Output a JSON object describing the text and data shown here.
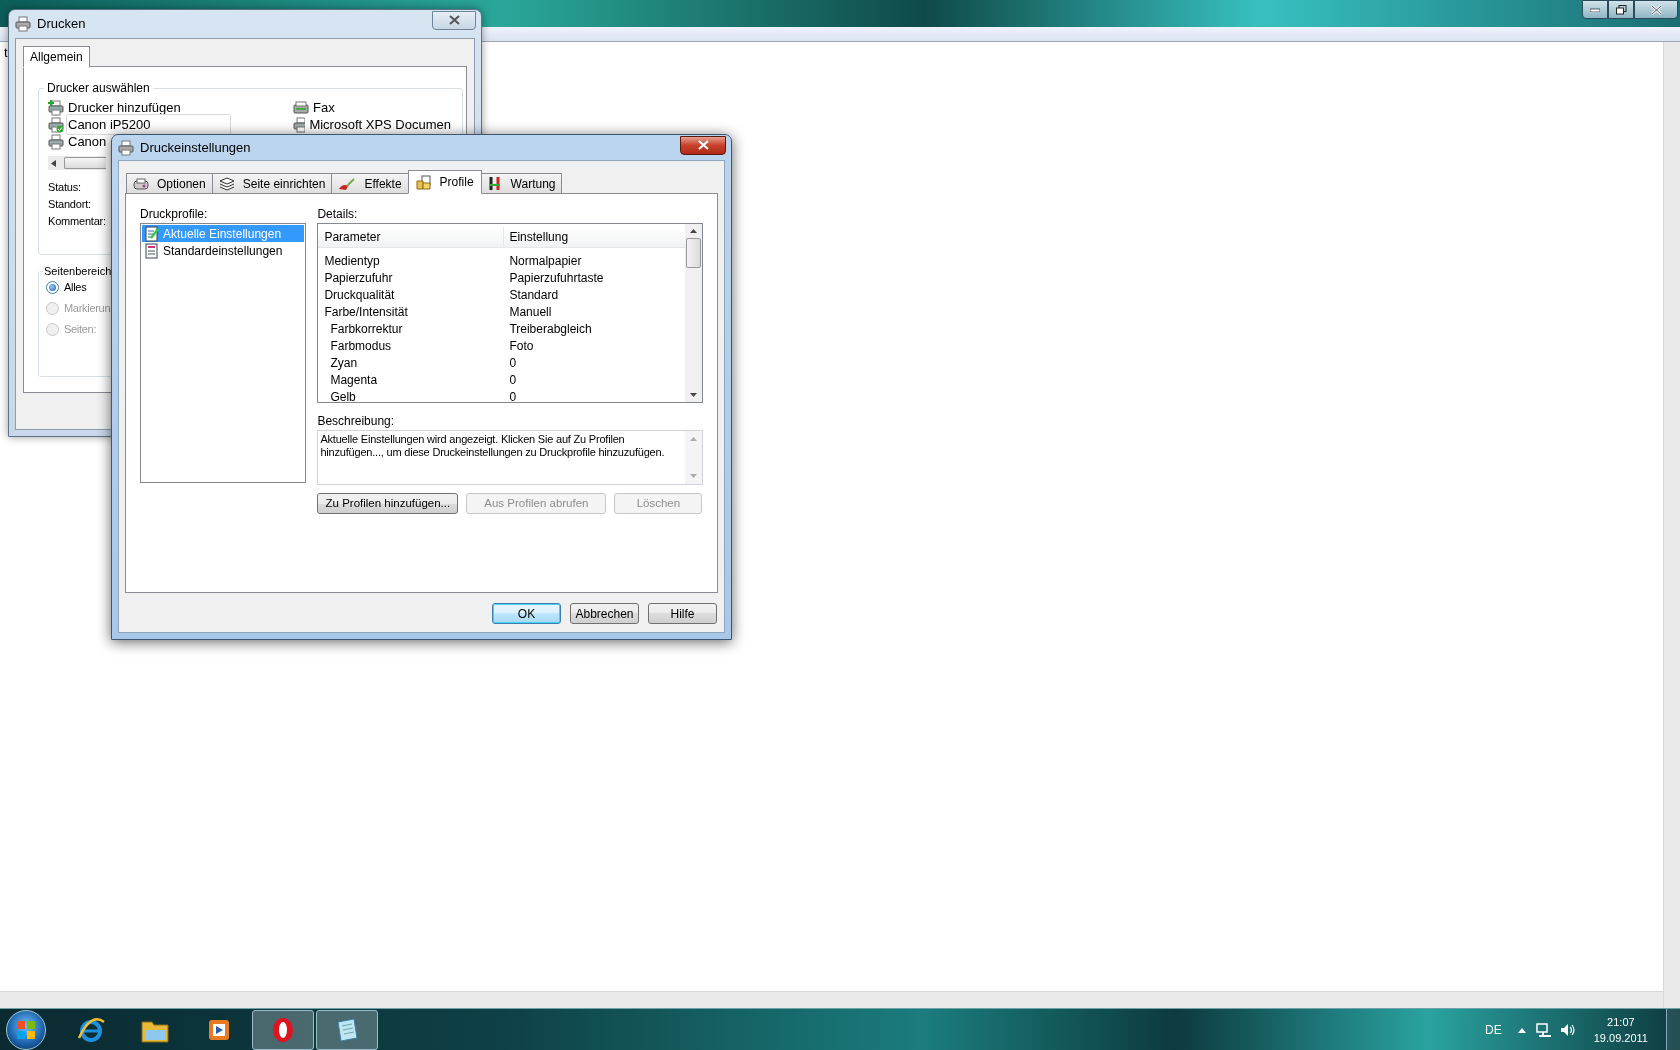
{
  "editor": {
    "text": "t"
  },
  "print_dialog": {
    "title": "Drucken",
    "tabs": [
      {
        "label": "Allgemein",
        "selected": true
      }
    ],
    "printer_group": {
      "title": "Drucker auswählen",
      "printers": [
        {
          "name": "Drucker hinzufügen",
          "kind": "add",
          "selected": false
        },
        {
          "name": "Canon iP5200",
          "kind": "default",
          "selected": true
        },
        {
          "name": "Canon",
          "kind": "printer",
          "selected": false
        },
        {
          "name": "Fax",
          "kind": "fax",
          "selected": false
        },
        {
          "name": "Microsoft XPS Documen",
          "kind": "printer",
          "selected": false
        }
      ]
    },
    "info_labels": [
      "Status:",
      "Standort:",
      "Kommentar:"
    ],
    "page_range": {
      "title": "Seitenbereich",
      "options": [
        {
          "label": "Alles",
          "selected": true,
          "disabled": false
        },
        {
          "label": "Markierun",
          "selected": false,
          "disabled": true
        },
        {
          "label": "Seiten:",
          "selected": false,
          "disabled": true
        }
      ]
    }
  },
  "settings_dialog": {
    "title": "Druckeinstellungen",
    "tabs": [
      {
        "label": "Optionen",
        "kind": "options",
        "selected": false
      },
      {
        "label": "Seite einrichten",
        "kind": "page",
        "selected": false
      },
      {
        "label": "Effekte",
        "kind": "effects",
        "selected": false
      },
      {
        "label": "Profile",
        "kind": "profiles",
        "selected": true
      },
      {
        "label": "Wartung",
        "kind": "maintenance",
        "selected": false
      }
    ],
    "profiles_label": "Druckprofile:",
    "profiles": [
      {
        "name": "Aktuelle Einstellungen",
        "kind": "current",
        "selected": true
      },
      {
        "name": "Standardeinstellungen",
        "kind": "default",
        "selected": false
      }
    ],
    "details_label": "Details:",
    "columns": [
      "Parameter",
      "Einstellung"
    ],
    "rows": [
      {
        "parameter": "Medientyp",
        "setting": "Normalpapier"
      },
      {
        "parameter": "Papierzufuhr",
        "setting": "Papierzufuhrtaste"
      },
      {
        "parameter": "Druckqualität",
        "setting": "Standard"
      },
      {
        "parameter": "Farbe/Intensität",
        "setting": "Manuell",
        "children": [
          {
            "parameter": "Farbkorrektur",
            "setting": "Treiberabgleich"
          },
          {
            "parameter": "Farbmodus",
            "setting": "Foto"
          },
          {
            "parameter": "Zyan",
            "setting": "0"
          },
          {
            "parameter": "Magenta",
            "setting": "0"
          },
          {
            "parameter": "Gelb",
            "setting": "0"
          }
        ]
      }
    ],
    "description_label": "Beschreibung:",
    "description": "Aktuelle Einstellungen wird angezeigt. Klicken Sie auf Zu Profilen hinzufügen..., um diese Druckeinstellungen zu Druckprofile hinzuzufügen.",
    "actions": [
      {
        "label": "Zu Profilen hinzufügen...",
        "disabled": false
      },
      {
        "label": "Aus Profilen abrufen",
        "disabled": true
      },
      {
        "label": "Löschen",
        "disabled": true
      }
    ],
    "buttons": [
      {
        "label": "OK",
        "default": true
      },
      {
        "label": "Abbrechen",
        "default": false
      },
      {
        "label": "Hilfe",
        "default": false
      }
    ]
  },
  "taskbar": {
    "apps": [
      {
        "kind": "browser",
        "running": false
      },
      {
        "kind": "folder",
        "running": false
      },
      {
        "kind": "media",
        "running": false
      },
      {
        "kind": "opera",
        "running": true
      },
      {
        "kind": "notepad",
        "running": true
      }
    ],
    "language": "DE",
    "time": "21:07",
    "date": "19.09.2011"
  }
}
